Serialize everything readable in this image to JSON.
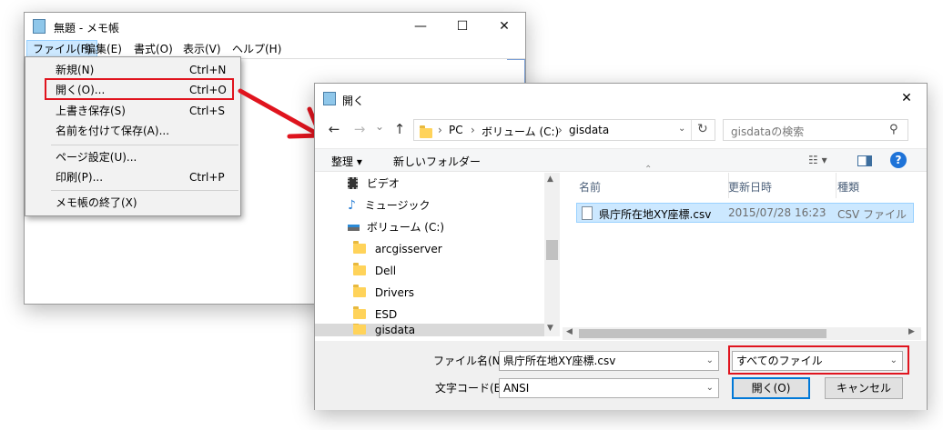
{
  "notepad": {
    "title": "無題 - メモ帳",
    "controls": {
      "minimize": "—",
      "maximize": "☐",
      "close": "✕"
    },
    "menubar": [
      "ファイル(F)",
      "編集(E)",
      "書式(O)",
      "表示(V)",
      "ヘルプ(H)"
    ],
    "file_menu": [
      {
        "label": "新規(N)",
        "shortcut": "Ctrl+N"
      },
      {
        "label": "開く(O)...",
        "shortcut": "Ctrl+O"
      },
      {
        "label": "上書き保存(S)",
        "shortcut": "Ctrl+S"
      },
      {
        "label": "名前を付けて保存(A)...",
        "shortcut": ""
      },
      {
        "label": "ページ設定(U)...",
        "shortcut": ""
      },
      {
        "label": "印刷(P)...",
        "shortcut": "Ctrl+P"
      },
      {
        "label": "メモ帳の終了(X)",
        "shortcut": ""
      }
    ]
  },
  "dialog": {
    "title": "開く",
    "close": "✕",
    "nav": {
      "back": "←",
      "forward": "→",
      "recent": "⌄",
      "up": "↑"
    },
    "breadcrumb": [
      "PC",
      "ボリューム (C:)",
      "gisdata"
    ],
    "breadcrumb_sep": "›",
    "search_placeholder": "gisdataの検索",
    "toolbar": {
      "organize": "整理 ▾",
      "new_folder": "新しいフォルダー",
      "help": "?"
    },
    "tree": [
      {
        "label": "ビデオ",
        "icon": "video-icon"
      },
      {
        "label": "ミュージック",
        "icon": "music-icon"
      },
      {
        "label": "ボリューム (C:)",
        "icon": "drive-icon"
      },
      {
        "label": "arcgisserver",
        "icon": "folder-icon"
      },
      {
        "label": "Dell",
        "icon": "folder-icon"
      },
      {
        "label": "Drivers",
        "icon": "folder-icon"
      },
      {
        "label": "ESD",
        "icon": "folder-icon"
      },
      {
        "label": "gisdata",
        "icon": "folder-icon"
      }
    ],
    "columns": [
      "名前",
      "更新日時",
      "種類"
    ],
    "files": [
      {
        "name": "県庁所在地XY座標.csv",
        "date": "2015/07/28 16:23",
        "type": "CSV ファイル"
      }
    ],
    "filename_label": "ファイル名(N):",
    "filename_value": "県庁所在地XY座標.csv",
    "filetype_value": "すべてのファイル",
    "encoding_label": "文字コード(E):",
    "encoding_value": "ANSI",
    "open_button": "開く(O)",
    "cancel_button": "キャンセル"
  },
  "colors": {
    "highlight": "#e0141e",
    "selection": "#cce8ff",
    "accent": "#0078d7",
    "folder": "#ffd35a"
  }
}
